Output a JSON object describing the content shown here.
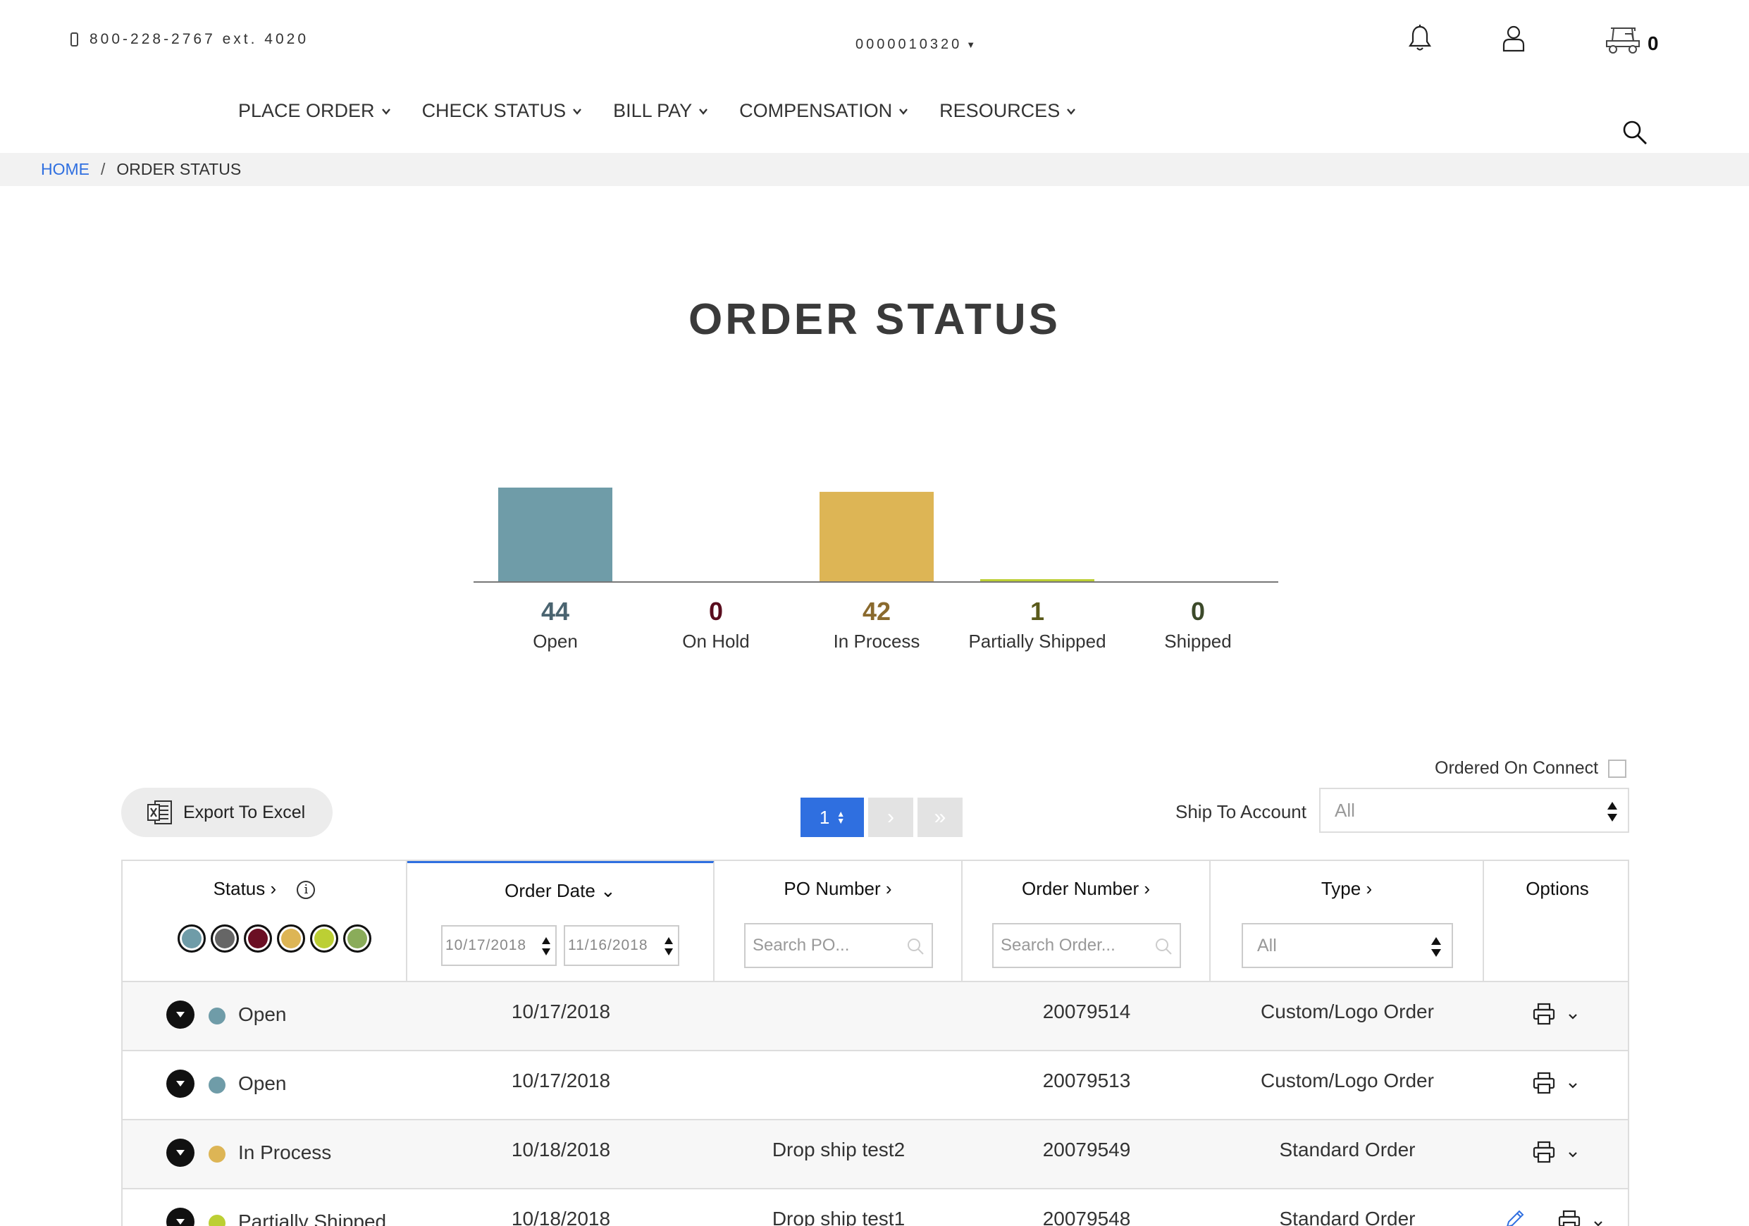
{
  "header": {
    "phone": "800-228-2767 ext. 4020",
    "account_number": "0000010320",
    "cart_count": "0"
  },
  "nav": {
    "items": [
      {
        "label": "PLACE ORDER"
      },
      {
        "label": "CHECK STATUS"
      },
      {
        "label": "BILL PAY"
      },
      {
        "label": "COMPENSATION"
      },
      {
        "label": "RESOURCES"
      }
    ]
  },
  "breadcrumb": {
    "home": "HOME",
    "separator": "/",
    "current": "ORDER STATUS"
  },
  "page": {
    "title": "ORDER STATUS"
  },
  "chart_data": {
    "type": "bar",
    "categories": [
      "Open",
      "On Hold",
      "In Process",
      "Partially Shipped",
      "Shipped"
    ],
    "values": [
      44,
      0,
      42,
      1,
      0
    ],
    "bar_colors": [
      "#6f9ca8",
      "#6b0f24",
      "#ddb555",
      "#bccf34",
      "#8aac5a"
    ],
    "value_label_colors": [
      "#4a6470",
      "#5a0d1e",
      "#8a6a2e",
      "#5a5a1a",
      "#3c4a2a"
    ]
  },
  "toolbar": {
    "ordered_on_connect_label": "Ordered On Connect",
    "export_label": "Export To Excel",
    "current_page": "1",
    "next_glyph": "›",
    "last_glyph": "»",
    "ship_to_label": "Ship To Account",
    "ship_to_value": "All"
  },
  "table": {
    "headers": {
      "status": "Status",
      "order_date": "Order Date",
      "po_number": "PO Number",
      "order_number": "Order Number",
      "type": "Type",
      "options": "Options"
    },
    "filters": {
      "date_from": "10/17/2018",
      "date_to": "11/16/2018",
      "po_placeholder": "Search PO...",
      "order_placeholder": "Search Order...",
      "type_value": "All"
    },
    "status_legend_colors": [
      "#6f9ca8",
      "#666666",
      "#6b0f24",
      "#ddb555",
      "#bccf34",
      "#8aac5a"
    ],
    "rows": [
      {
        "status": "Open",
        "status_color": "#6f9ca8",
        "order_date": "10/17/2018",
        "po": "",
        "order_number": "20079514",
        "type": "Custom/Logo Order",
        "editable": false
      },
      {
        "status": "Open",
        "status_color": "#6f9ca8",
        "order_date": "10/17/2018",
        "po": "",
        "order_number": "20079513",
        "type": "Custom/Logo Order",
        "editable": false
      },
      {
        "status": "In Process",
        "status_color": "#ddb555",
        "order_date": "10/18/2018",
        "po": "Drop ship test2",
        "order_number": "20079549",
        "type": "Standard Order",
        "editable": false
      },
      {
        "status": "Partially Shipped",
        "status_color": "#bccf34",
        "order_date": "10/18/2018",
        "po": "Drop ship test1",
        "order_number": "20079548",
        "type": "Standard Order",
        "editable": true
      }
    ]
  }
}
